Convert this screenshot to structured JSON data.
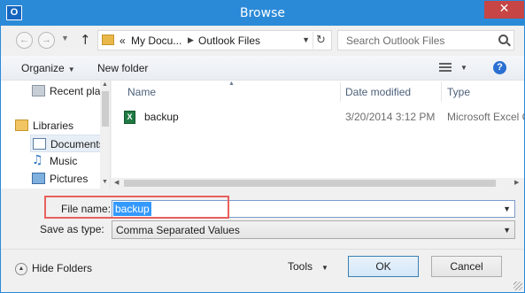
{
  "window": {
    "title": "Browse",
    "app_icon_letter": "O",
    "close_glyph": "✕",
    "accent_color": "#2b8ad8"
  },
  "nav": {
    "back_icon": "back-arrow-icon",
    "forward_icon": "forward-arrow-icon",
    "up_glyph": "↑",
    "address": {
      "overflow_glyph": "«",
      "crumbs": [
        "My Docu...",
        "Outlook Files"
      ],
      "refresh_glyph": "↻"
    },
    "search_placeholder": "Search Outlook Files"
  },
  "commands": {
    "organize_label": "Organize",
    "new_folder_label": "New folder",
    "help_glyph": "?"
  },
  "sidebar": {
    "items": [
      {
        "label": "Recent places",
        "icon": "recent-places-icon"
      },
      {
        "label": "Libraries",
        "icon": "libraries-icon"
      },
      {
        "label": "Documents",
        "icon": "document-icon",
        "selected": true
      },
      {
        "label": "Music",
        "icon": "music-icon"
      },
      {
        "label": "Pictures",
        "icon": "pictures-icon"
      }
    ]
  },
  "files": {
    "columns": [
      "Name",
      "Date modified",
      "Type"
    ],
    "rows": [
      {
        "name": "backup",
        "date": "3/20/2014 3:12 PM",
        "type": "Microsoft Excel Comma Separated Values File",
        "icon": "excel-file-icon",
        "icon_letter": "X"
      }
    ]
  },
  "form": {
    "file_name_label": "File name:",
    "file_name_value": "backup",
    "save_type_label": "Save as type:",
    "save_type_value": "Comma Separated Values",
    "highlight_color": "#e8605e"
  },
  "footer": {
    "hide_folders_label": "Hide Folders",
    "tools_label": "Tools",
    "ok_label": "OK",
    "cancel_label": "Cancel"
  }
}
